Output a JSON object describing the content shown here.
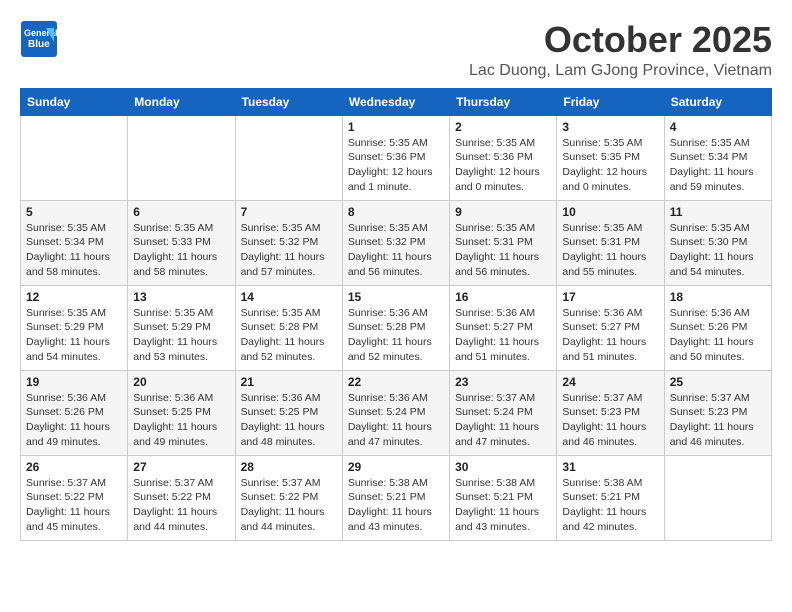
{
  "header": {
    "logo_general": "General",
    "logo_blue": "Blue",
    "month_title": "October 2025",
    "location": "Lac Duong, Lam GJong Province, Vietnam"
  },
  "days_of_week": [
    "Sunday",
    "Monday",
    "Tuesday",
    "Wednesday",
    "Thursday",
    "Friday",
    "Saturday"
  ],
  "weeks": [
    [
      {
        "day": "",
        "info": ""
      },
      {
        "day": "",
        "info": ""
      },
      {
        "day": "",
        "info": ""
      },
      {
        "day": "1",
        "info": "Sunrise: 5:35 AM\nSunset: 5:36 PM\nDaylight: 12 hours\nand 1 minute."
      },
      {
        "day": "2",
        "info": "Sunrise: 5:35 AM\nSunset: 5:36 PM\nDaylight: 12 hours\nand 0 minutes."
      },
      {
        "day": "3",
        "info": "Sunrise: 5:35 AM\nSunset: 5:35 PM\nDaylight: 12 hours\nand 0 minutes."
      },
      {
        "day": "4",
        "info": "Sunrise: 5:35 AM\nSunset: 5:34 PM\nDaylight: 11 hours\nand 59 minutes."
      }
    ],
    [
      {
        "day": "5",
        "info": "Sunrise: 5:35 AM\nSunset: 5:34 PM\nDaylight: 11 hours\nand 58 minutes."
      },
      {
        "day": "6",
        "info": "Sunrise: 5:35 AM\nSunset: 5:33 PM\nDaylight: 11 hours\nand 58 minutes."
      },
      {
        "day": "7",
        "info": "Sunrise: 5:35 AM\nSunset: 5:32 PM\nDaylight: 11 hours\nand 57 minutes."
      },
      {
        "day": "8",
        "info": "Sunrise: 5:35 AM\nSunset: 5:32 PM\nDaylight: 11 hours\nand 56 minutes."
      },
      {
        "day": "9",
        "info": "Sunrise: 5:35 AM\nSunset: 5:31 PM\nDaylight: 11 hours\nand 56 minutes."
      },
      {
        "day": "10",
        "info": "Sunrise: 5:35 AM\nSunset: 5:31 PM\nDaylight: 11 hours\nand 55 minutes."
      },
      {
        "day": "11",
        "info": "Sunrise: 5:35 AM\nSunset: 5:30 PM\nDaylight: 11 hours\nand 54 minutes."
      }
    ],
    [
      {
        "day": "12",
        "info": "Sunrise: 5:35 AM\nSunset: 5:29 PM\nDaylight: 11 hours\nand 54 minutes."
      },
      {
        "day": "13",
        "info": "Sunrise: 5:35 AM\nSunset: 5:29 PM\nDaylight: 11 hours\nand 53 minutes."
      },
      {
        "day": "14",
        "info": "Sunrise: 5:35 AM\nSunset: 5:28 PM\nDaylight: 11 hours\nand 52 minutes."
      },
      {
        "day": "15",
        "info": "Sunrise: 5:36 AM\nSunset: 5:28 PM\nDaylight: 11 hours\nand 52 minutes."
      },
      {
        "day": "16",
        "info": "Sunrise: 5:36 AM\nSunset: 5:27 PM\nDaylight: 11 hours\nand 51 minutes."
      },
      {
        "day": "17",
        "info": "Sunrise: 5:36 AM\nSunset: 5:27 PM\nDaylight: 11 hours\nand 51 minutes."
      },
      {
        "day": "18",
        "info": "Sunrise: 5:36 AM\nSunset: 5:26 PM\nDaylight: 11 hours\nand 50 minutes."
      }
    ],
    [
      {
        "day": "19",
        "info": "Sunrise: 5:36 AM\nSunset: 5:26 PM\nDaylight: 11 hours\nand 49 minutes."
      },
      {
        "day": "20",
        "info": "Sunrise: 5:36 AM\nSunset: 5:25 PM\nDaylight: 11 hours\nand 49 minutes."
      },
      {
        "day": "21",
        "info": "Sunrise: 5:36 AM\nSunset: 5:25 PM\nDaylight: 11 hours\nand 48 minutes."
      },
      {
        "day": "22",
        "info": "Sunrise: 5:36 AM\nSunset: 5:24 PM\nDaylight: 11 hours\nand 47 minutes."
      },
      {
        "day": "23",
        "info": "Sunrise: 5:37 AM\nSunset: 5:24 PM\nDaylight: 11 hours\nand 47 minutes."
      },
      {
        "day": "24",
        "info": "Sunrise: 5:37 AM\nSunset: 5:23 PM\nDaylight: 11 hours\nand 46 minutes."
      },
      {
        "day": "25",
        "info": "Sunrise: 5:37 AM\nSunset: 5:23 PM\nDaylight: 11 hours\nand 46 minutes."
      }
    ],
    [
      {
        "day": "26",
        "info": "Sunrise: 5:37 AM\nSunset: 5:22 PM\nDaylight: 11 hours\nand 45 minutes."
      },
      {
        "day": "27",
        "info": "Sunrise: 5:37 AM\nSunset: 5:22 PM\nDaylight: 11 hours\nand 44 minutes."
      },
      {
        "day": "28",
        "info": "Sunrise: 5:37 AM\nSunset: 5:22 PM\nDaylight: 11 hours\nand 44 minutes."
      },
      {
        "day": "29",
        "info": "Sunrise: 5:38 AM\nSunset: 5:21 PM\nDaylight: 11 hours\nand 43 minutes."
      },
      {
        "day": "30",
        "info": "Sunrise: 5:38 AM\nSunset: 5:21 PM\nDaylight: 11 hours\nand 43 minutes."
      },
      {
        "day": "31",
        "info": "Sunrise: 5:38 AM\nSunset: 5:21 PM\nDaylight: 11 hours\nand 42 minutes."
      },
      {
        "day": "",
        "info": ""
      }
    ]
  ]
}
